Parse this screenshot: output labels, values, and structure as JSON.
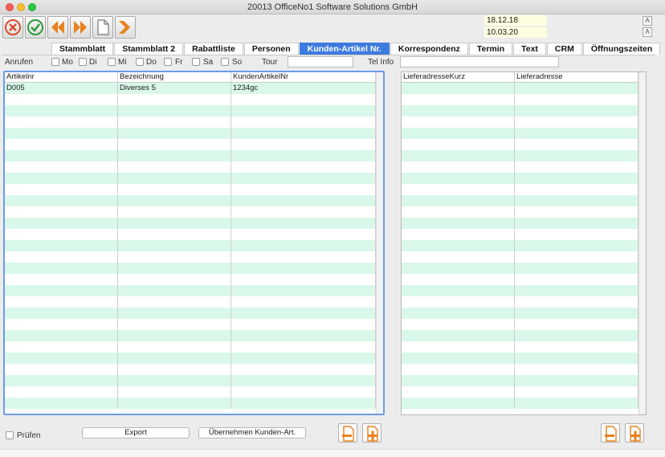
{
  "window": {
    "title": "20013 OfficeNo1 Software Solutions GmbH"
  },
  "dates": {
    "date1": "18.12.18",
    "date2": "10.03.20"
  },
  "tabs": [
    {
      "label": "Stammblatt"
    },
    {
      "label": "Stammblatt 2"
    },
    {
      "label": "Rabattliste"
    },
    {
      "label": "Personen"
    },
    {
      "label": "Kunden-Artikel Nr."
    },
    {
      "label": "Korrespondenz"
    },
    {
      "label": "Termin"
    },
    {
      "label": "Text"
    },
    {
      "label": "CRM"
    },
    {
      "label": "Öffnungszeiten"
    }
  ],
  "active_tab": "Kunden-Artikel Nr.",
  "call": {
    "label": "Anrufen",
    "days": [
      "Mo",
      "Di",
      "Mi",
      "Do",
      "Fr",
      "Sa",
      "So"
    ],
    "tour_label": "Tour",
    "tour_value": "",
    "telinfo_label": "Tel Info",
    "telinfo_value": ""
  },
  "left_grid": {
    "columns": [
      "Artikelnr",
      "Bezeichnung",
      "KundenArtikelNr"
    ],
    "rows": [
      [
        "D005",
        "Diverses 5",
        "1234gc"
      ]
    ]
  },
  "right_grid": {
    "columns": [
      "LieferadresseKurz",
      "Lieferadresse"
    ],
    "rows": []
  },
  "bottom": {
    "check_label": "Prüfen",
    "export_label": "Export",
    "uebernehmen_label": "Übernehmen Kunden-Art."
  },
  "colors": {
    "accent": "#3d7be0",
    "row_alt": "#d9f8e9",
    "date_bg": "#fdfde0"
  }
}
